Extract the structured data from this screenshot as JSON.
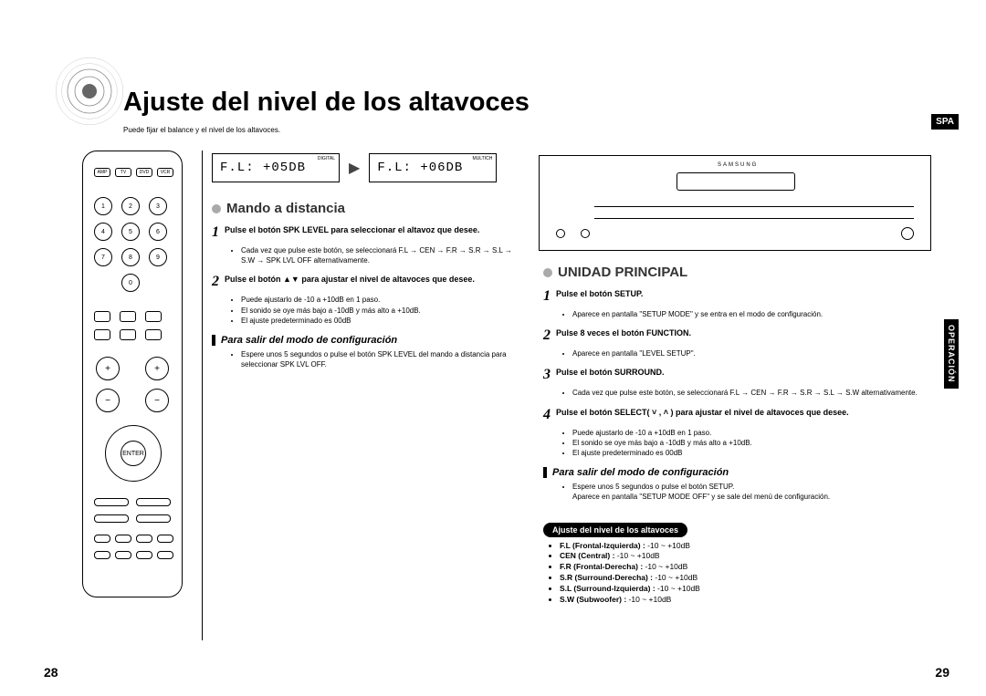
{
  "page_title": "Ajuste del nivel de los altavoces",
  "page_subtitle": "Puede fijar el balance y el nivel de los altavoces.",
  "tab_spa": "SPA",
  "side_tab": "OPERACIÓN",
  "lcd1": "F.L: +05DB",
  "lcd2": "F.L: +06DB",
  "lcd_tiny1": "DIGITAL",
  "lcd_tiny2": "MULTICH",
  "remote_top": [
    "AMP",
    "TV",
    "DVD",
    "VCR"
  ],
  "remote_nums": [
    "1",
    "2",
    "3",
    "4",
    "5",
    "6",
    "7",
    "8",
    "9",
    "0"
  ],
  "remote_enter": "ENTER",
  "left": {
    "title": "Mando a distancia",
    "step1_num": "1",
    "step1_text": "Pulse el botón SPK LEVEL para seleccionar el altavoz que desee.",
    "step1_bullet": "Cada vez que pulse este botón, se seleccionará F.L → CEN → F.R → S.R → S.L → S.W → SPK LVL OFF alternativamente.",
    "step2_num": "2",
    "step2_text": "Pulse el botón ▲▼ para ajustar el nivel de altavoces que desee.",
    "step2_b1": "Puede ajustarlo de -10 a +10dB en 1 paso.",
    "step2_b2": "El sonido se oye más bajo a -10dB y más alto a +10dB.",
    "step2_b3": "El ajuste predeterminado es 00dB",
    "exit_heading": "Para salir del modo de configuración",
    "exit_bullet": "Espere unos 5 segundos o pulse el botón SPK LEVEL del mando a distancia para seleccionar SPK LVL OFF."
  },
  "right": {
    "title": "UNIDAD PRINCIPAL",
    "step1_num": "1",
    "step1_text": "Pulse el botón SETUP.",
    "step1_b1": "Aparece en pantalla \"SETUP MODE\" y se entra en el modo de configuración.",
    "step2_num": "2",
    "step2_text": "Pulse 8 veces el botón FUNCTION.",
    "step2_b1": "Aparece en pantalla \"LEVEL SETUP\".",
    "step3_num": "3",
    "step3_text": "Pulse el botón SURROUND.",
    "step3_b1": "Cada vez que pulse este botón, se seleccionará F.L → CEN → F.R → S.R → S.L → S.W alternativamente.",
    "step4_num": "4",
    "step4_text": "Pulse el botón SELECT( ˅ , ˄ ) para ajustar el nivel de altavoces que desee.",
    "step4_b1": "Puede ajustarlo de -10 a +10dB en 1 paso.",
    "step4_b2": "El sonido se oye más bajo a -10dB y más alto a +10dB.",
    "step4_b3": "El ajuste predeterminado es 00dB",
    "exit_heading": "Para salir del modo de configuración",
    "exit_b1": "Espere unos 5 segundos o pulse el botón SETUP.",
    "exit_b2": "Aparece en pantalla \"SETUP MODE OFF\" y se sale del menú de configuración."
  },
  "range_pill": "Ajuste del nivel de los altavoces",
  "ranges": [
    {
      "label": "F.L (Frontal-Izquierda) :",
      "val": " -10 ~ +10dB"
    },
    {
      "label": "CEN (Central) :",
      "val": " -10 ~ +10dB"
    },
    {
      "label": "F.R (Frontal-Derecha) :",
      "val": " -10 ~ +10dB"
    },
    {
      "label": "S.R (Surround-Derecha) :",
      "val": " -10 ~ +10dB"
    },
    {
      "label": "S.L (Surround-Izquierda) :",
      "val": " -10 ~ +10dB"
    },
    {
      "label": "S.W (Subwoofer) :",
      "val": " -10 ~ +10dB"
    }
  ],
  "page_left": "28",
  "page_right": "29",
  "brand": "SAMSUNG"
}
